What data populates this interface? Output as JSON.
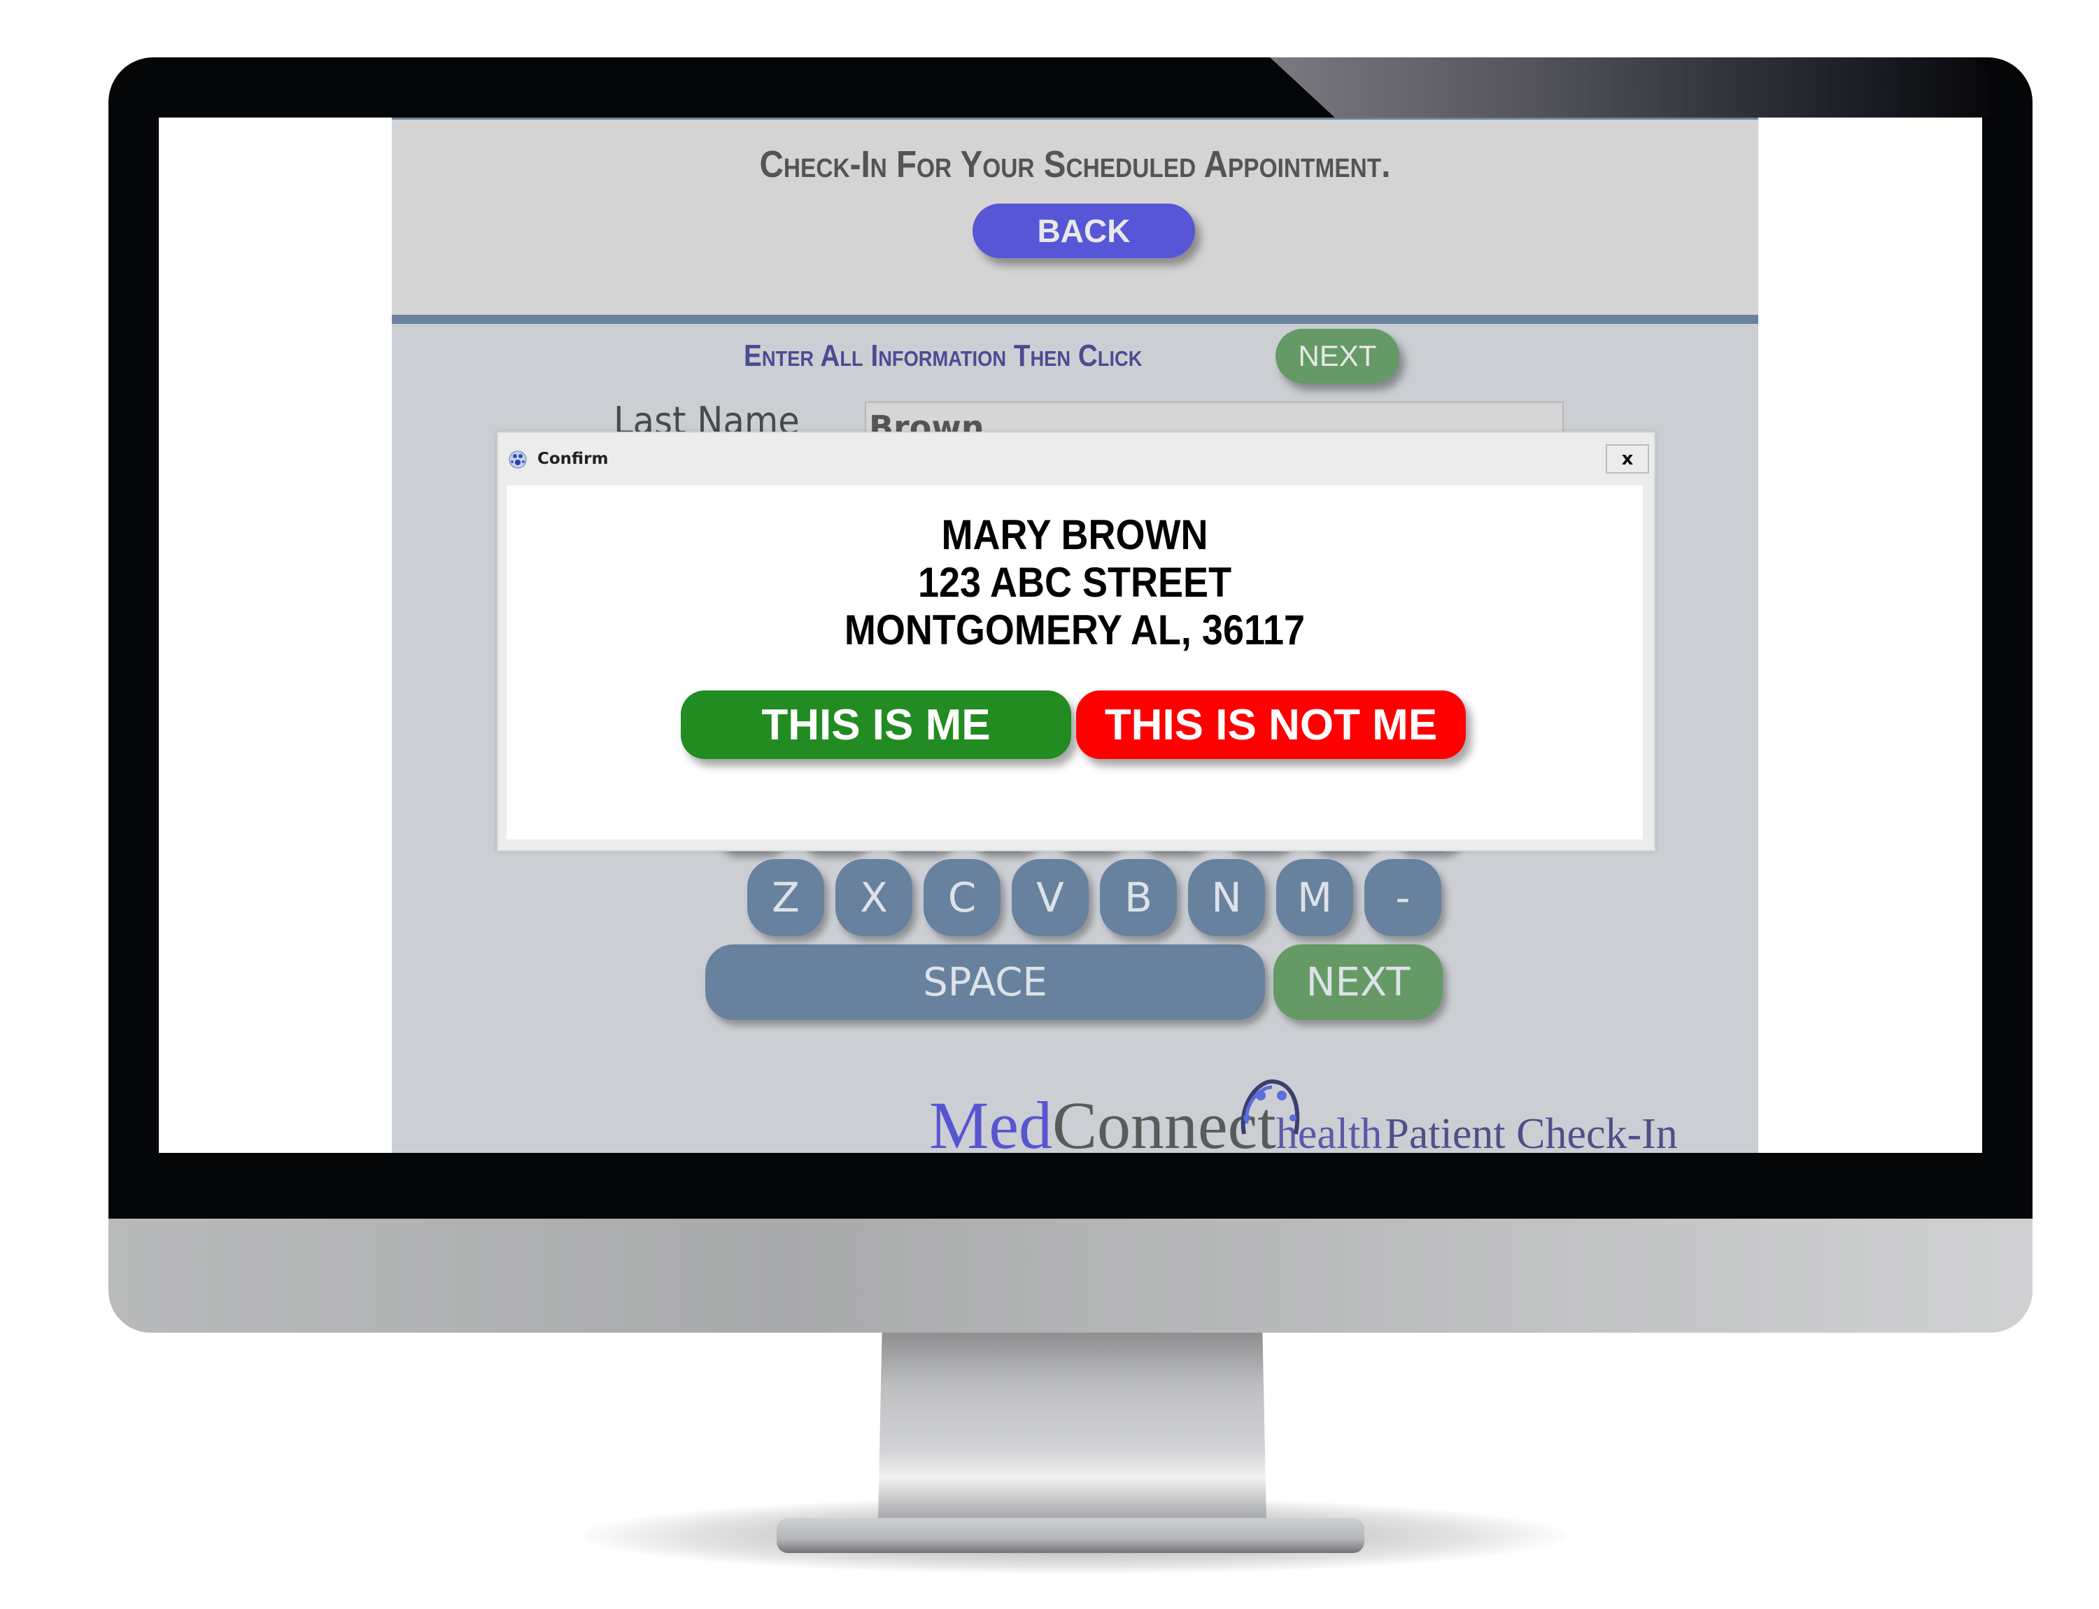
{
  "app": {
    "title": "Check-In For Your Scheduled Appointment.",
    "back_label": "BACK",
    "instruction": "Enter All Information Then Click",
    "instruction_next_label": "NEXT",
    "fields": [
      {
        "label": "Last Name",
        "value": "Brown"
      }
    ],
    "keyboard": {
      "row_hidden_count": 9,
      "row_bottom": [
        "Z",
        "X",
        "C",
        "V",
        "B",
        "N",
        "M",
        "-"
      ],
      "space_label": "SPACE",
      "next_label": "NEXT"
    },
    "logo": {
      "med": "Med",
      "connect": "Connect",
      "health": "health",
      "suffix": "Patient Check-In"
    }
  },
  "dialog": {
    "title": "Confirm",
    "close_label": "x",
    "name": "MARY BROWN",
    "street": "123 ABC STREET",
    "city_line": "MONTGOMERY AL, 36117",
    "confirm_label": "THIS IS ME",
    "reject_label": "THIS IS NOT ME"
  },
  "colors": {
    "back_button": "#5656d6",
    "next_button": "#659a66",
    "key": "#68819e",
    "confirm_button": "#228b22",
    "reject_button": "#ff0000",
    "instruction_text": "#4b4b92"
  }
}
